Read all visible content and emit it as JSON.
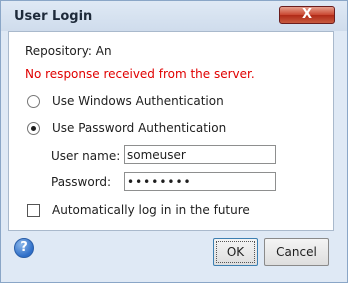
{
  "window": {
    "title": "User Login",
    "close_label": "X"
  },
  "content": {
    "repository_label": "Repository: An",
    "error_message": "No response received from the server.",
    "auth_options": [
      {
        "label": "Use Windows Authentication",
        "selected": false
      },
      {
        "label": "Use Password Authentication",
        "selected": true
      }
    ],
    "username_label": "User name:",
    "username_value": "someuser",
    "password_label": "Password:",
    "password_value": "••••••••",
    "auto_login_label": "Automatically log in in the future",
    "auto_login_checked": false
  },
  "footer": {
    "help_label": "?",
    "ok_label": "OK",
    "cancel_label": "Cancel"
  },
  "colors": {
    "error": "#e00000",
    "title_bar": "#dfe9f5",
    "close_button": "#c9452f"
  }
}
